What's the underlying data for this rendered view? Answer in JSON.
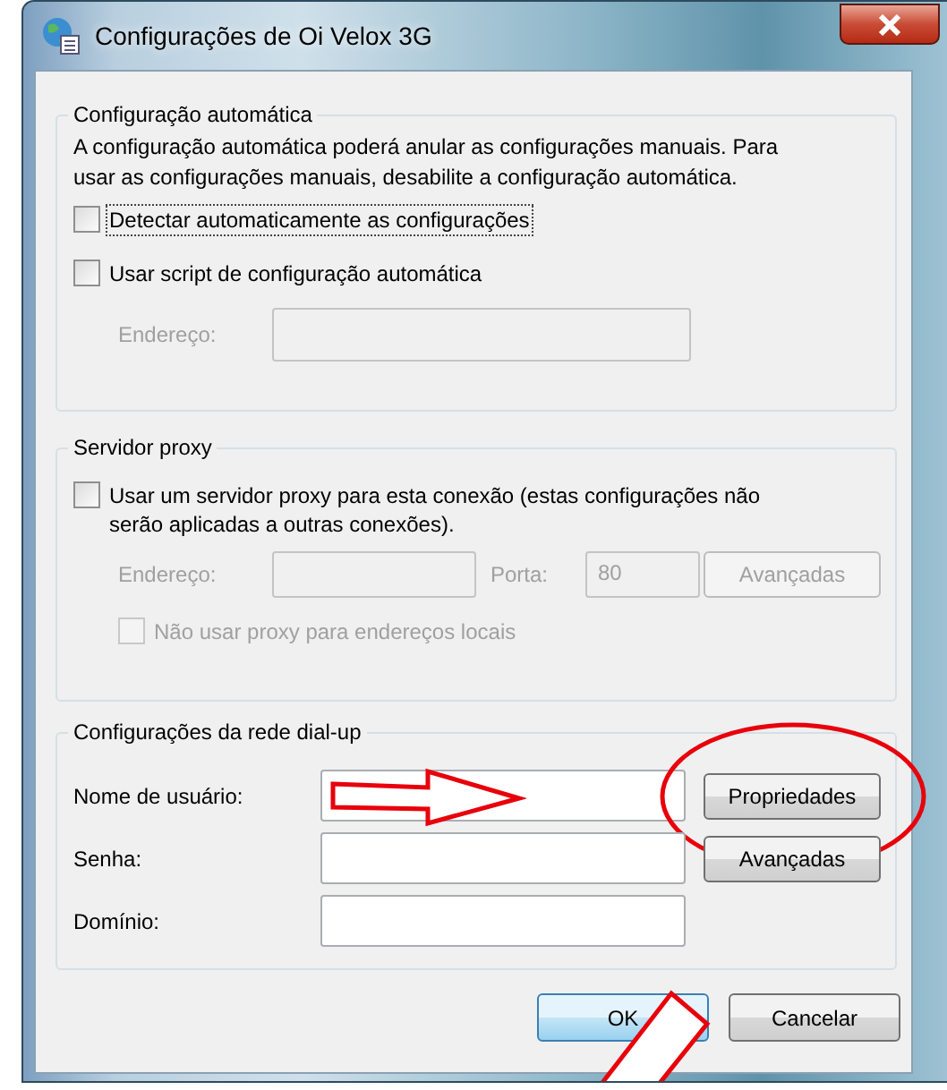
{
  "window": {
    "title": "Configurações de Oi Velox 3G"
  },
  "groups": [
    {
      "title": "Configuração automática",
      "rows": [
        {
          "kind": "text",
          "text": "A configuração automática poderá anular as configurações manuais. Para usar as configurações manuais, desabilite a configuração automática."
        },
        {
          "kind": "checkbox",
          "label": "Detectar automaticamente as configurações",
          "checked": false,
          "disabled": false,
          "focused": true
        },
        {
          "kind": "checkbox",
          "label": "Usar script de configuração automática",
          "checked": false,
          "disabled": false,
          "focused": false
        },
        {
          "kind": "fields",
          "fields": [
            {
              "label": "Endereço:",
              "disabled": true
            }
          ]
        }
      ]
    },
    {
      "title": "Servidor proxy",
      "rows": [
        {
          "kind": "checkbox",
          "label": "Usar um servidor proxy para esta conexão (estas configurações não serão aplicadas a outras conexões).",
          "checked": false,
          "disabled": false,
          "focused": false
        },
        {
          "kind": "fields",
          "fields": [
            {
              "label": "Endereço:",
              "disabled": true
            },
            {
              "label": "Porta:",
              "value": "80",
              "disabled": true
            }
          ],
          "button": {
            "label": "Avançadas",
            "disabled": true
          }
        },
        {
          "kind": "checkbox",
          "label": "Não usar proxy para endereços locais",
          "checked": false,
          "disabled": true,
          "focused": false
        }
      ]
    },
    {
      "title": "Configurações da rede dial-up",
      "rows": [
        {
          "kind": "fields",
          "fields": [
            {
              "label": "Nome de usuário:",
              "disabled": false,
              "arrow": true
            }
          ],
          "button": {
            "label": "Propriedades",
            "disabled": false,
            "circled": true
          }
        },
        {
          "kind": "fields",
          "fields": [
            {
              "label": "Senha:",
              "disabled": false
            }
          ],
          "button": {
            "label": "Avançadas",
            "disabled": false
          }
        },
        {
          "kind": "fields",
          "fields": [
            {
              "label": "Domínio:",
              "disabled": false
            }
          ]
        }
      ]
    }
  ],
  "buttons": [
    {
      "label": "OK",
      "default": true
    },
    {
      "label": "Cancelar",
      "default": false
    }
  ],
  "pointer_arrow": true
}
